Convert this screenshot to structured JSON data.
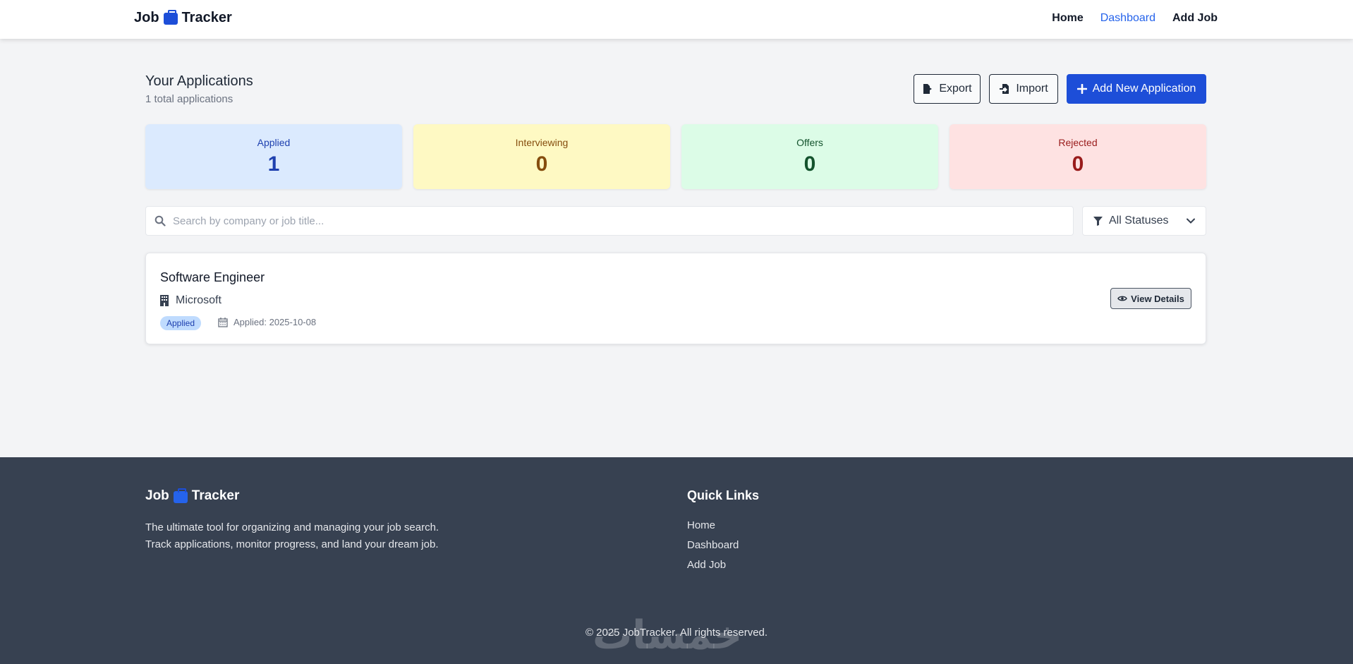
{
  "header": {
    "brand_left": "Job",
    "brand_right": "Tracker",
    "nav": [
      {
        "label": "Home",
        "active": false
      },
      {
        "label": "Dashboard",
        "active": true
      },
      {
        "label": "Add Job",
        "active": false
      }
    ]
  },
  "main": {
    "title": "Your Applications",
    "subtitle": "1 total applications",
    "buttons": {
      "export": "Export",
      "import": "Import",
      "add": "Add New Application"
    },
    "stats": [
      {
        "label": "Applied",
        "value": "1"
      },
      {
        "label": "Interviewing",
        "value": "0"
      },
      {
        "label": "Offers",
        "value": "0"
      },
      {
        "label": "Rejected",
        "value": "0"
      }
    ],
    "search": {
      "placeholder": "Search by company or job title...",
      "value": ""
    },
    "filter": {
      "selected": "All Statuses"
    },
    "applications": [
      {
        "title": "Software Engineer",
        "company": "Microsoft",
        "status": "Applied",
        "applied_date": "Applied: 2025-10-08",
        "action": "View Details"
      }
    ]
  },
  "footer": {
    "brand_left": "Job",
    "brand_right": "Tracker",
    "description_line1": "The ultimate tool for organizing and managing your job search.",
    "description_line2": "Track applications, monitor progress, and land your dream job.",
    "quick_links_title": "Quick Links",
    "quick_links": [
      "Home",
      "Dashboard",
      "Add Job"
    ],
    "copyright": "© 2025 JobTracker. All rights reserved.",
    "watermark": "خمسات"
  },
  "colors": {
    "accent": "#1d4ed8",
    "nav_active": "#2563eb",
    "footer_bg": "#374151",
    "page_bg": "#f3f4f6"
  },
  "icons": [
    "briefcase-icon",
    "file-export-icon",
    "file-import-icon",
    "plus-icon",
    "search-icon",
    "filter-icon",
    "chevron-down-icon",
    "building-icon",
    "calendar-icon",
    "eye-icon"
  ]
}
